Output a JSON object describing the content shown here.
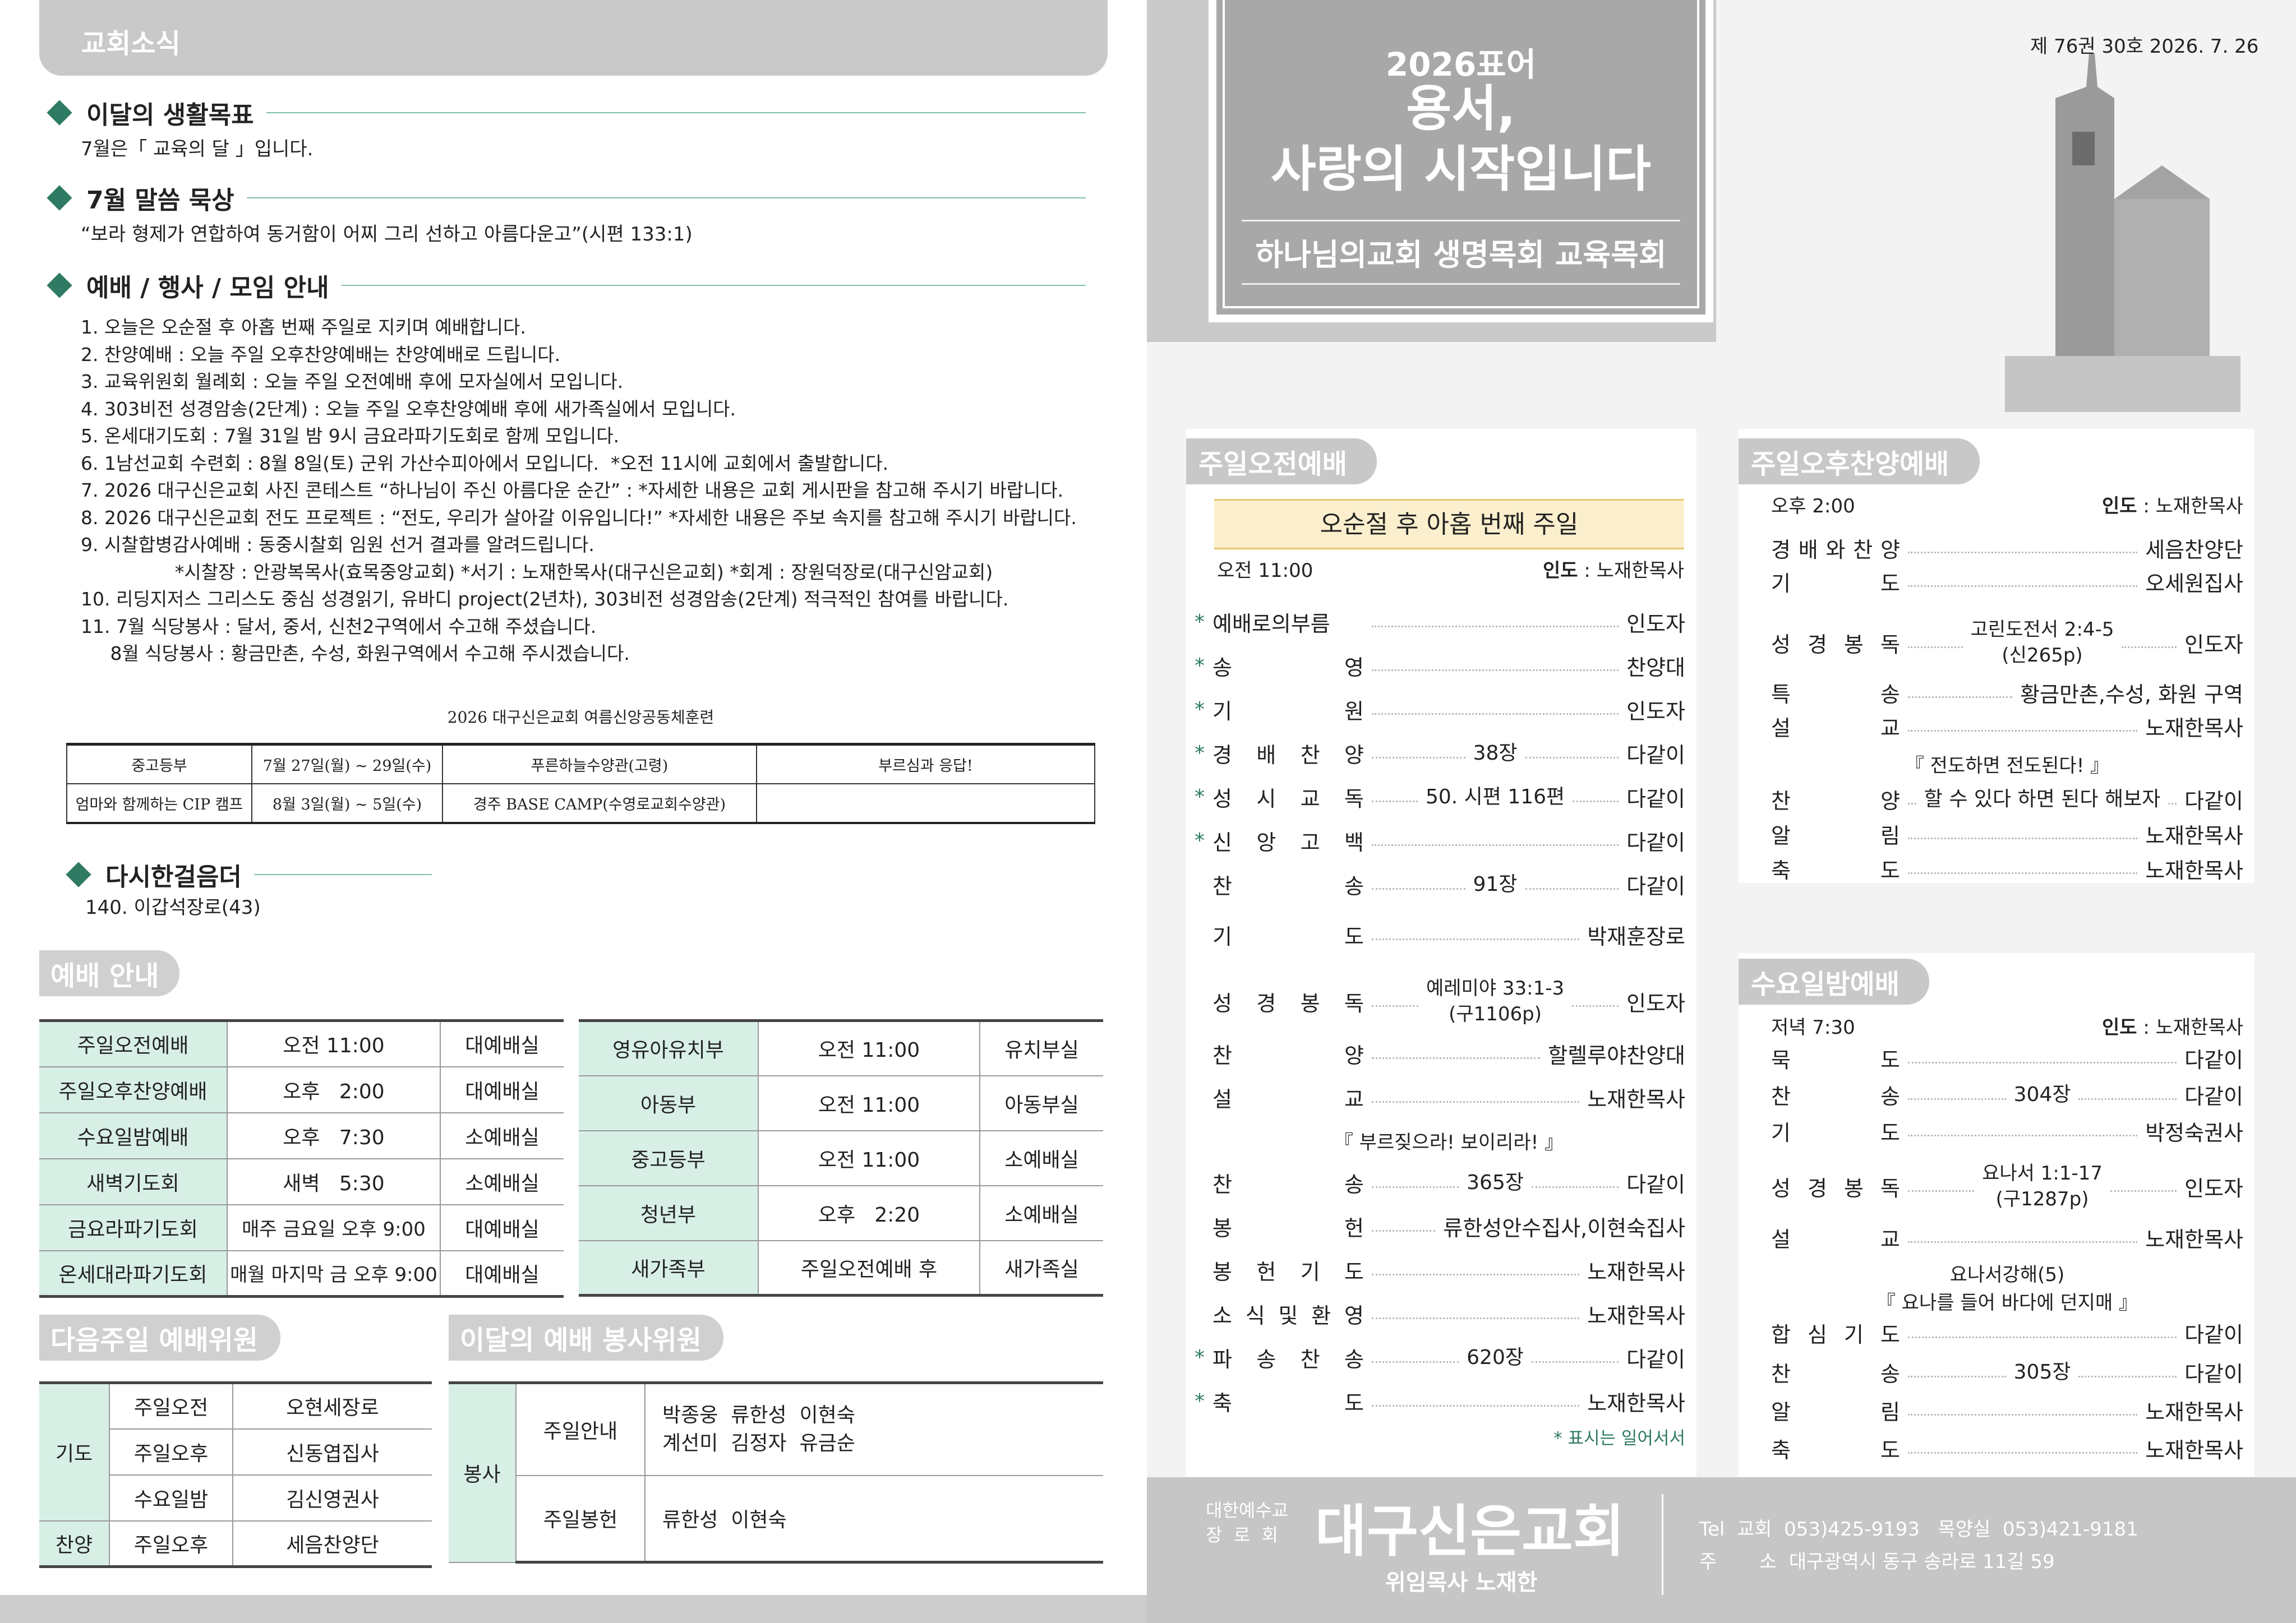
{
  "left": {
    "header": "교회소식",
    "goal": {
      "title": "이달의 생활목표",
      "text": "7월은「 교육의 달 」입니다."
    },
    "verse": {
      "title": "7월 말씀 묵상",
      "text": "“보라 형제가 연합하여 동거함이 어찌 그리 선하고 아름다운고”(시편 133:1)"
    },
    "notices": {
      "title": "예배 / 행사 / 모임 안내",
      "items": [
        "1. 오늘은 오순절 후 아홉 번째 주일로 지키며 예배합니다.",
        "2. 찬양예배 : 오늘 주일 오후찬양예배는 찬양예배로 드립니다.",
        "3. 교육위원회 월례회 : 오늘 주일 오전예배 후에 모자실에서 모입니다.",
        "4. 303비전 성경암송(2단계) : 오늘 주일 오후찬양예배 후에 새가족실에서 모입니다.",
        "5. 온세대기도회 : 7월 31일 밤 9시 금요라파기도회로 함께 모입니다.",
        "6. 1남선교회 수련회 : 8월 8일(토) 군위 가산수피아에서 모입니다.  *오전 11시에 교회에서 출발합니다.",
        "7. 2026 대구신은교회 사진 콘테스트 “하나님이 주신 아름다운 순간” : *자세한 내용은 교회 게시판을 참고해 주시기 바랍니다.",
        "8. 2026 대구신은교회 전도 프로젝트 : “전도, 우리가 살아갈 이유입니다!” *자세한 내용은 주보 속지를 참고해 주시기 바랍니다.",
        "9. 시찰합병감사예배 : 동중시찰회 임원 선거 결과를 알려드립니다.",
        "                *시찰장 : 안광복목사(효목중앙교회) *서기 : 노재한목사(대구신은교회) *회계 : 장원덕장로(대구신암교회)",
        "10. 리딩지저스 그리스도 중심 성경읽기, 유바디 project(2년차), 303비전 성경암송(2단계) 적극적인 참여를 바랍니다.",
        "11. 7월 식당봉사 : 달서, 중서, 신천2구역에서 수고해 주셨습니다.",
        "     8월 식당봉사 : 황금만촌, 수성, 화원구역에서 수고해 주시겠습니다."
      ]
    },
    "camp": {
      "title": "2026 대구신은교회 여름신앙공동체훈련",
      "rows": [
        [
          "중고등부",
          "7월 27일(월) ~ 29일(수)",
          "푸른하늘수양관(고령)",
          "부르심과 응답!"
        ],
        [
          "엄마와 함께하는 CIP 캠프",
          "8월 3일(월) ~ 5일(수)",
          "경주 BASE CAMP(수영로교회수양관)",
          ""
        ]
      ]
    },
    "again": {
      "title": "다시한걸음더",
      "text": "140. 이갑석장로(43)"
    },
    "worship_info": {
      "title": "예배 안내",
      "left": [
        [
          "주일오전예배",
          "오전 11:00",
          "대예배실"
        ],
        [
          "주일오후찬양예배",
          "오후   2:00",
          "대예배실"
        ],
        [
          "수요일밤예배",
          "오후   7:30",
          "소예배실"
        ],
        [
          "새벽기도회",
          "새벽   5:30",
          "소예배실"
        ],
        [
          "금요라파기도회",
          "매주 금요일 오후 9:00",
          "대예배실"
        ],
        [
          "온세대라파기도회",
          "매월 마지막 금 오후 9:00",
          "대예배실"
        ]
      ],
      "right": [
        [
          "영유아유치부",
          "오전 11:00",
          "유치부실"
        ],
        [
          "아동부",
          "오전 11:00",
          "아동부실"
        ],
        [
          "중고등부",
          "오전 11:00",
          "소예배실"
        ],
        [
          "청년부",
          "오후   2:20",
          "소예배실"
        ],
        [
          "새가족부",
          "주일오전예배 후",
          "새가족실"
        ]
      ]
    },
    "next_week": {
      "title": "다음주일 예배위원",
      "g1": "기도",
      "g2": "찬양",
      "rows": [
        [
          "주일오전",
          "오현세장로"
        ],
        [
          "주일오후",
          "신동엽집사"
        ],
        [
          "수요일밤",
          "김신영권사"
        ],
        [
          "주일오후",
          "세음찬양단"
        ]
      ]
    },
    "volunteers": {
      "title": "이달의 예배 봉사위원",
      "group": "봉사",
      "rows": [
        [
          "주일안내",
          "박종웅  류한성  이현숙",
          "계선미  김정자  유금순"
        ],
        [
          "주일봉헌",
          "류한성  이현숙",
          ""
        ]
      ]
    }
  },
  "right": {
    "hero": {
      "year": "2026표어",
      "line1": "용서,",
      "line2": "사랑의 시작입니다",
      "sub": "하나님의교회 생명목회 교육목회"
    },
    "issue": "제 76권 30호 2026. 7. 26",
    "morning": {
      "title": "주일오전예배",
      "banner": "오순절 후 아홉 번째 주일",
      "time": "오전 11:00",
      "leader_k": "인도",
      "leader_v": " : 노재한목사",
      "note": "* 표시는 일어서서",
      "rows": [
        {
          "s": "*",
          "l": "예배로의부름",
          "m": "",
          "r": "인도자"
        },
        {
          "s": "*",
          "l": "송영",
          "m": "",
          "r": "찬양대"
        },
        {
          "s": "*",
          "l": "기원",
          "m": "",
          "r": "인도자"
        },
        {
          "s": "*",
          "l": "경배찬양",
          "m": "38장",
          "r": "다같이"
        },
        {
          "s": "*",
          "l": "성시교독",
          "m": "50. 시편 116편",
          "r": "다같이"
        },
        {
          "s": "*",
          "l": "신앙고백",
          "m": "",
          "r": "다같이"
        },
        {
          "s": "",
          "l": "찬송",
          "m": "91장",
          "r": "다같이"
        },
        {
          "s": "",
          "l": "기도",
          "m": "",
          "r": "박재훈장로"
        },
        {
          "s": "",
          "l": "성경봉독",
          "m": "예레미야 33:1-3",
          "m2": "(구1106p)",
          "r": "인도자"
        },
        {
          "s": "",
          "l": "찬양",
          "m": "",
          "r": "할렐루야찬양대"
        },
        {
          "s": "",
          "l": "설교",
          "m": "",
          "r": "노재한목사"
        },
        {
          "s": "",
          "l": "",
          "m": "『 부르짖으라! 보이리라! 』",
          "r": ""
        },
        {
          "s": "",
          "l": "찬송",
          "m": "365장",
          "r": "다같이"
        },
        {
          "s": "",
          "l": "봉헌",
          "m": "",
          "r": "류한성안수집사,이현숙집사"
        },
        {
          "s": "",
          "l": "봉헌기도",
          "m": "",
          "r": "노재한목사"
        },
        {
          "s": "",
          "l": "소식및환영",
          "m": "",
          "r": "노재한목사"
        },
        {
          "s": "*",
          "l": "파송찬송",
          "m": "620장",
          "r": "다같이"
        },
        {
          "s": "*",
          "l": "축도",
          "m": "",
          "r": "노재한목사"
        }
      ]
    },
    "afternoon": {
      "title": "주일오후찬양예배",
      "time": "오후 2:00",
      "leader_k": "인도",
      "leader_v": " : 노재한목사",
      "rows": [
        {
          "l": "경배와찬양",
          "m": "",
          "r": "세음찬양단"
        },
        {
          "l": "기도",
          "m": "",
          "r": "오세원집사"
        },
        {
          "l": "성경봉독",
          "m": "고린도전서 2:4-5",
          "m2": "(신265p)",
          "r": "인도자"
        },
        {
          "l": "특송",
          "m": "",
          "r": "황금만촌,수성, 화원 구역"
        },
        {
          "l": "설교",
          "m": "",
          "r": "노재한목사"
        },
        {
          "l": "",
          "m": "『 전도하면 전도된다! 』",
          "r": ""
        },
        {
          "l": "찬양",
          "m": "할 수 있다 하면 된다 해보자",
          "r": "다같이"
        },
        {
          "l": "알림",
          "m": "",
          "r": "노재한목사"
        },
        {
          "l": "축도",
          "m": "",
          "r": "노재한목사"
        }
      ]
    },
    "wednesday": {
      "title": "수요일밤예배",
      "time": "저녁 7:30",
      "leader_k": "인도",
      "leader_v": " : 노재한목사",
      "rows": [
        {
          "l": "묵도",
          "m": "",
          "r": "다같이"
        },
        {
          "l": "찬송",
          "m": "304장",
          "r": "다같이"
        },
        {
          "l": "기도",
          "m": "",
          "r": "박정숙권사"
        },
        {
          "l": "성경봉독",
          "m": "요나서 1:1-17",
          "m2": "(구1287p)",
          "r": "인도자"
        },
        {
          "l": "설교",
          "m": "",
          "r": "노재한목사"
        },
        {
          "l": "",
          "m": "요나서강해(5)",
          "r": ""
        },
        {
          "l": "",
          "m": "『 요나를 들어 바다에 던지매 』",
          "r": ""
        },
        {
          "l": "합심기도",
          "m": "",
          "r": "다같이"
        },
        {
          "l": "찬송",
          "m": "305장",
          "r": "다같이"
        },
        {
          "l": "알림",
          "m": "",
          "r": "노재한목사"
        },
        {
          "l": "축도",
          "m": "",
          "r": "노재한목사"
        }
      ]
    },
    "footer": {
      "denom1": "대한예수교",
      "denom2": "장  로  회",
      "church": "대구신은교회",
      "pastor": "위임목사 노재한",
      "tel": "Tel  교회  053)425-9193   목양실  053)421-9181",
      "addr": "주       소  대구광역시 동구 송라로 11길 59"
    }
  }
}
